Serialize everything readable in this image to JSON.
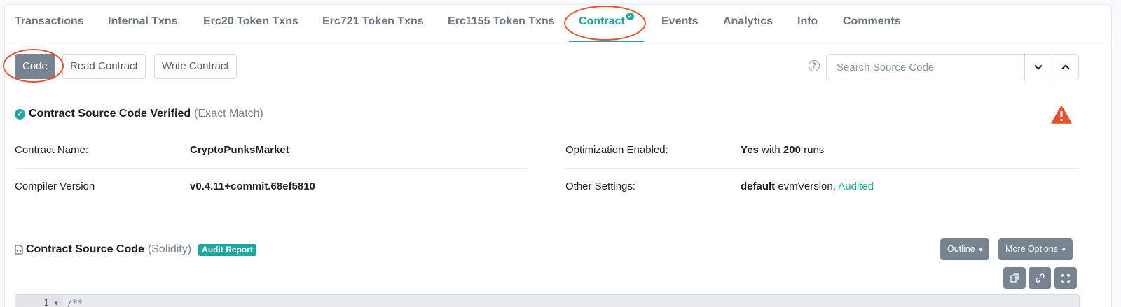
{
  "tabs": [
    {
      "label": "Transactions"
    },
    {
      "label": "Internal Txns"
    },
    {
      "label": "Erc20 Token Txns"
    },
    {
      "label": "Erc721 Token Txns"
    },
    {
      "label": "Erc1155 Token Txns"
    },
    {
      "label": "Contract",
      "active": true
    },
    {
      "label": "Events"
    },
    {
      "label": "Analytics"
    },
    {
      "label": "Info"
    },
    {
      "label": "Comments"
    }
  ],
  "sub_tabs": {
    "code": "Code",
    "read": "Read Contract",
    "write": "Write Contract"
  },
  "search": {
    "placeholder": "Search Source Code"
  },
  "verified": {
    "title": "Contract Source Code Verified",
    "match": "(Exact Match)"
  },
  "info": {
    "contract_name_label": "Contract Name:",
    "contract_name_value": "CryptoPunksMarket",
    "compiler_label": "Compiler Version",
    "compiler_value": "v0.4.11+commit.68ef5810",
    "optimization_label": "Optimization Enabled:",
    "optimization_yes": "Yes",
    "optimization_with": "with",
    "optimization_runs": "200",
    "optimization_runs_suffix": "runs",
    "other_label": "Other Settings:",
    "other_default": "default",
    "other_evm": "evmVersion,",
    "other_audited": "Audited"
  },
  "source": {
    "title": "Contract Source Code",
    "lang": "(Solidity)",
    "badge": "Audit Report",
    "outline_label": "Outline",
    "more_label": "More Options",
    "line_no": "1",
    "first_line": "/**"
  },
  "colors": {
    "accent": "#21a6a2",
    "annotation": "#e8512f",
    "warning": "#e8512f",
    "button_gray": "#77838f"
  }
}
